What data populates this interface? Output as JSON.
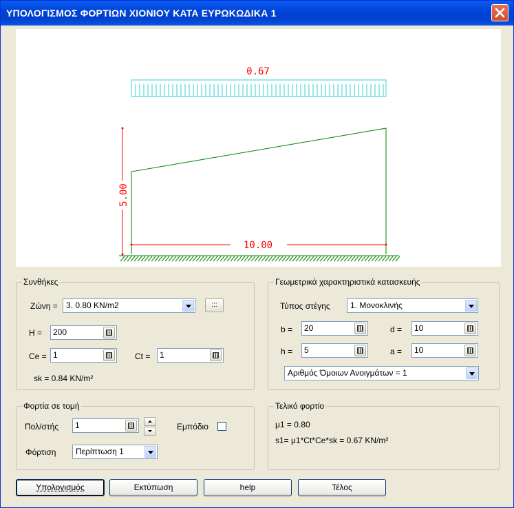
{
  "window": {
    "title": "ΥΠΟΛΟΓΙΣΜΟΣ ΦΟΡΤΙΩΝ ΧΙΟΝΙΟΥ ΚΑΤΑ ΕΥΡΩΚΩΔΙΚΑ 1"
  },
  "drawing": {
    "load_value": "0.67",
    "height_dim": "5.00",
    "width_dim": "10.00",
    "colors": {
      "load": "#2fd3d6",
      "dimension": "#ff0000",
      "structure": "#008000"
    }
  },
  "conditions": {
    "legend": "Συνθήκες",
    "zone_label": "Ζώνη =",
    "zone_value": "3. 0.80 KN/m2",
    "dots_button": ":::",
    "h_label": "H =",
    "h_value": "200",
    "ce_label": "Ce =",
    "ce_value": "1",
    "ct_label": "Ct =",
    "ct_value": "1",
    "sk_text": "sk = 0.84 KN/m²"
  },
  "geometry": {
    "legend": "Γεωμετρικά χαρακτηριστικά κατασκευής",
    "roof_type_label": "Τύπος στέγης",
    "roof_type_value": "1. Μονοκλινής",
    "b_label": "b =",
    "b_value": "20",
    "d_label": "d =",
    "d_value": "10",
    "h_label": "h =",
    "h_value": "5",
    "a_label": "a =",
    "a_value": "10",
    "spans_value": "Αριθμός Όμοιων Ανοιγμάτων = 1"
  },
  "section_loads": {
    "legend": "Φορτία σε τομή",
    "multi_label": "Πολ/στής",
    "multi_value": "1",
    "obstacle_label": "Εμπόδιο",
    "load_label": "Φόρτιση",
    "load_value": "Περίπτωση 1"
  },
  "final_load": {
    "legend": "Τελικό φορτίο",
    "mu_text": "μ1 = 0.80",
    "s_text": "s1= μ1*Ct*Ce*sk = 0.67 KN/m²"
  },
  "buttons": {
    "calculate": "Υπολογισμός",
    "print": "Εκτύπωση",
    "help": "help",
    "end": "Τέλος"
  }
}
